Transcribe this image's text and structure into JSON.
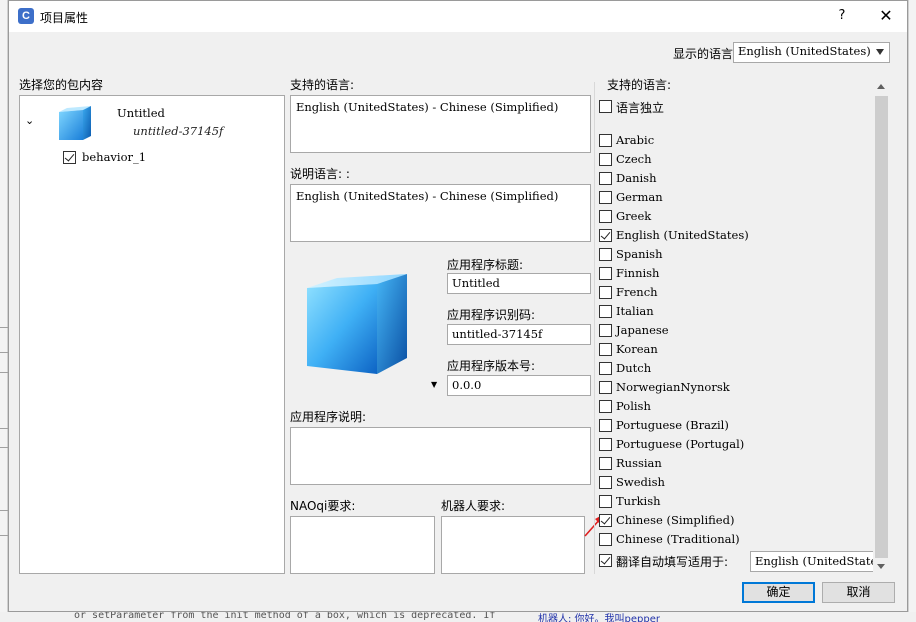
{
  "window": {
    "title": "项目属性",
    "app_icon_letter": "C",
    "help_label": "?",
    "close_label": "✕"
  },
  "display_language": {
    "label": "显示的语言",
    "value": "English (UnitedStates)"
  },
  "package": {
    "heading": "选择您的包内容",
    "project_name": "Untitled",
    "project_id": "untitled-37145f",
    "behavior": {
      "label": "behavior_1",
      "checked": true
    }
  },
  "supported_languages_mid": {
    "label": "支持的语言:",
    "value": "English (UnitedStates) - Chinese (Simplified)"
  },
  "description_language": {
    "label": "说明语言: :",
    "value": "English (UnitedStates) - Chinese (Simplified)"
  },
  "app_title": {
    "label": "应用程序标题:",
    "value": "Untitled"
  },
  "app_id": {
    "label": "应用程序识别码:",
    "value": "untitled-37145f"
  },
  "app_version": {
    "label": "应用程序版本号:",
    "value": "0.0.0"
  },
  "app_description": {
    "label": "应用程序说明:",
    "value": ""
  },
  "naoqi_requirements": {
    "label": "NAOqi要求:",
    "value": ""
  },
  "robot_requirements": {
    "label": "机器人要求:",
    "value": ""
  },
  "languages_panel": {
    "heading": "支持的语言:",
    "independent": {
      "label": "语言独立",
      "checked": false
    },
    "items": [
      {
        "label": "Arabic",
        "checked": false
      },
      {
        "label": "Czech",
        "checked": false
      },
      {
        "label": "Danish",
        "checked": false
      },
      {
        "label": "German",
        "checked": false
      },
      {
        "label": "Greek",
        "checked": false
      },
      {
        "label": "English (UnitedStates)",
        "checked": true
      },
      {
        "label": "Spanish",
        "checked": false
      },
      {
        "label": "Finnish",
        "checked": false
      },
      {
        "label": "French",
        "checked": false
      },
      {
        "label": "Italian",
        "checked": false
      },
      {
        "label": "Japanese",
        "checked": false
      },
      {
        "label": "Korean",
        "checked": false
      },
      {
        "label": "Dutch",
        "checked": false
      },
      {
        "label": "NorwegianNynorsk",
        "checked": false
      },
      {
        "label": "Polish",
        "checked": false
      },
      {
        "label": "Portuguese (Brazil)",
        "checked": false
      },
      {
        "label": "Portuguese (Portugal)",
        "checked": false
      },
      {
        "label": "Russian",
        "checked": false
      },
      {
        "label": "Swedish",
        "checked": false
      },
      {
        "label": "Turkish",
        "checked": false
      },
      {
        "label": "Chinese (Simplified)",
        "checked": true
      },
      {
        "label": "Chinese (Traditional)",
        "checked": false
      }
    ],
    "auto_translate": {
      "label": "翻译自动填写适用于:",
      "checked": true,
      "value": "English (UnitedStates)"
    }
  },
  "buttons": {
    "ok": "确定",
    "cancel": "取消"
  },
  "background": {
    "bottom_left_text": "or setParameter from the init method of a box, which is deprecated. If",
    "bottom_right_text": "机器人: 你好。我叫pepper"
  }
}
